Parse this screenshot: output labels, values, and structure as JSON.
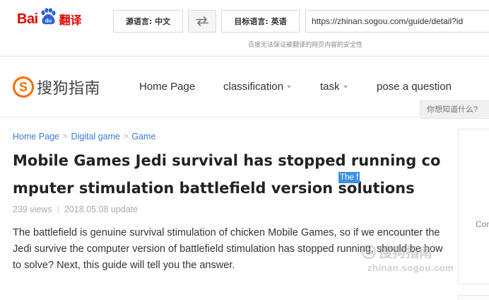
{
  "translate_bar": {
    "logo_text_bai": "Bai",
    "logo_text_fanyi": "翻译",
    "source_language": "源语言: 中文",
    "target_language": "目标语言: 英语",
    "url": "https://zhinan.sogou.com/guide/detail?id",
    "disclaimer": "百度无法保证被翻译的网页内容的安全性"
  },
  "site": {
    "brand_name": "搜狗指南",
    "brand_color": "#ff6a00",
    "nav": [
      {
        "label": "Home Page",
        "has_caret": false
      },
      {
        "label": "classification",
        "has_caret": true
      },
      {
        "label": "task",
        "has_caret": true
      },
      {
        "label": "pose a question",
        "has_caret": false
      }
    ],
    "search_placeholder": "你想知道什么?"
  },
  "article": {
    "breadcrumbs": [
      "Home Page",
      "Digital game",
      "Game"
    ],
    "breadcrumb_separator": ">",
    "title": "Mobile Games Jedi survival has stopped running computer stimulation battlefield version solutions",
    "highlight_text": "The f",
    "views": "239 views",
    "meta_separator": "|",
    "date": "2018.05.08 update",
    "body": "The battlefield is genuine survival stimulation of chicken Mobile Games, so if we encounter the Jedi survive the computer version of battlefield stimulation has stopped running, should be how to solve? Next, this guide will tell you the answer."
  },
  "watermark": {
    "text": "搜狗指南",
    "url": "zhinan.sogou.com"
  },
  "side_panel": {
    "text": "Cor"
  },
  "icons": {
    "logo_paw": "baidu-paw-icon",
    "swap": "swap-arrows-icon",
    "brand": "sogou-s-icon"
  }
}
